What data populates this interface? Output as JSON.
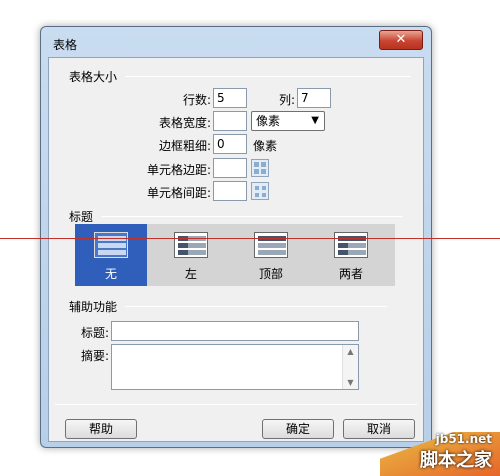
{
  "dialog": {
    "title": "表格",
    "close_symbol": "✕"
  },
  "table_size": {
    "section_title": "表格大小",
    "rows_label": "行数:",
    "rows_value": "5",
    "cols_label": "列:",
    "cols_value": "7",
    "width_label": "表格宽度:",
    "width_value": "",
    "width_unit_selected": "像素",
    "border_label": "边框粗细:",
    "border_value": "0",
    "border_unit": "像素",
    "padding_label": "单元格边距:",
    "padding_value": "",
    "spacing_label": "单元格间距:",
    "spacing_value": ""
  },
  "header": {
    "section_title": "标题",
    "options": [
      "无",
      "左",
      "顶部",
      "两者"
    ],
    "selected": "无"
  },
  "accessibility": {
    "section_title": "辅助功能",
    "caption_label": "标题:",
    "caption_value": "",
    "summary_label": "摘要:",
    "summary_value": ""
  },
  "buttons": {
    "help": "帮助",
    "ok": "确定",
    "cancel": "取消"
  },
  "watermark": {
    "site": "jb51.net",
    "brand": "脚本之家"
  },
  "icons": {
    "close": "close-icon",
    "dropdown": "chevron-down-icon",
    "scroll_up": "scroll-up-icon",
    "scroll_down": "scroll-down-icon"
  }
}
